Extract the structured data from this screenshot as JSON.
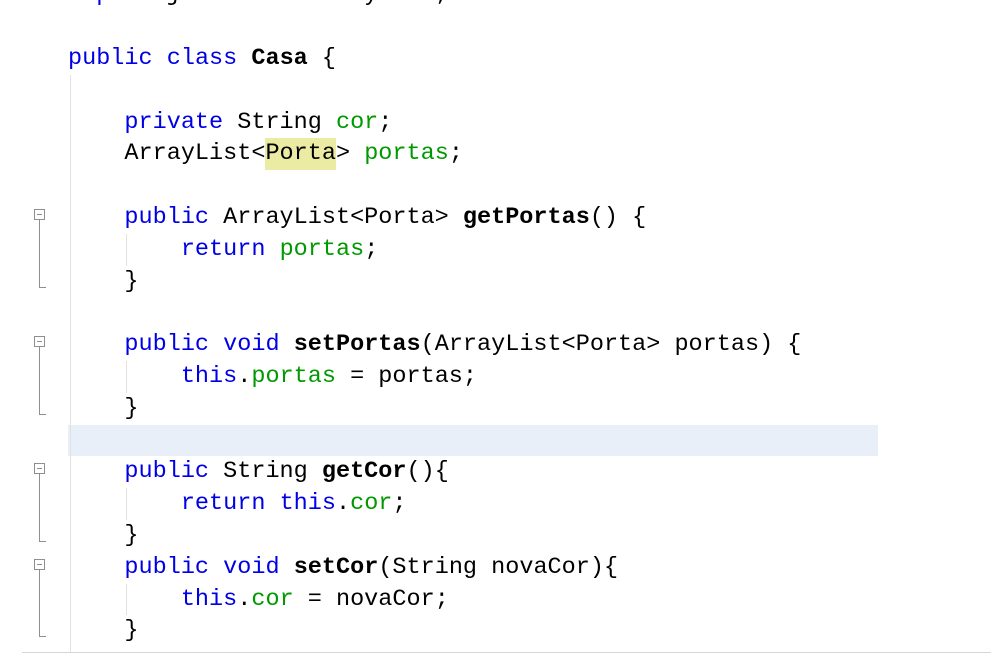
{
  "editor": {
    "language": "Java",
    "current_line": 14,
    "colors": {
      "background": "#ffffff",
      "text": "#000000",
      "keyword": "#0000e6",
      "field": "#009900",
      "current_line_bg": "#e9eff8",
      "occurrence_bg": "#eceba3",
      "fold_marker": "#8f8f8f",
      "indent_guide": "#e2e2e2",
      "border": "#d6d6d6"
    },
    "fold_icon": "fold-minus-icon",
    "blocks": [
      {
        "start": 0,
        "end": 0,
        "foldable": true
      },
      {
        "start": 2,
        "end": null,
        "foldable": false
      },
      {
        "start": 7,
        "end": 9,
        "foldable": true
      },
      {
        "start": 11,
        "end": 13,
        "foldable": true
      },
      {
        "start": 15,
        "end": 17,
        "foldable": true
      },
      {
        "start": 18,
        "end": 20,
        "foldable": true
      }
    ],
    "lines": [
      {
        "indent": 0,
        "tokens": [
          {
            "kind": "keyword",
            "text": "import"
          },
          {
            "kind": "text",
            "text": " java.util.ArrayList;"
          }
        ]
      },
      {
        "indent": 0,
        "tokens": []
      },
      {
        "indent": 0,
        "tokens": [
          {
            "kind": "keyword",
            "text": "public"
          },
          {
            "kind": "text",
            "text": " "
          },
          {
            "kind": "keyword",
            "text": "class"
          },
          {
            "kind": "text",
            "text": " "
          },
          {
            "kind": "declaration",
            "text": "Casa"
          },
          {
            "kind": "text",
            "text": " {"
          }
        ]
      },
      {
        "indent": 0,
        "tokens": []
      },
      {
        "indent": 4,
        "tokens": [
          {
            "kind": "keyword",
            "text": "private"
          },
          {
            "kind": "text",
            "text": " String "
          },
          {
            "kind": "field",
            "text": "cor"
          },
          {
            "kind": "text",
            "text": ";"
          }
        ]
      },
      {
        "indent": 4,
        "tokens": [
          {
            "kind": "text",
            "text": "ArrayList<"
          },
          {
            "kind": "occurrence",
            "text": "Porta"
          },
          {
            "kind": "text",
            "text": "> "
          },
          {
            "kind": "field",
            "text": "portas"
          },
          {
            "kind": "text",
            "text": ";"
          }
        ]
      },
      {
        "indent": 0,
        "tokens": []
      },
      {
        "indent": 4,
        "tokens": [
          {
            "kind": "keyword",
            "text": "public"
          },
          {
            "kind": "text",
            "text": " ArrayList<Porta> "
          },
          {
            "kind": "declaration",
            "text": "getPortas"
          },
          {
            "kind": "text",
            "text": "() {"
          }
        ]
      },
      {
        "indent": 8,
        "tokens": [
          {
            "kind": "keyword",
            "text": "return"
          },
          {
            "kind": "text",
            "text": " "
          },
          {
            "kind": "field",
            "text": "portas"
          },
          {
            "kind": "text",
            "text": ";"
          }
        ]
      },
      {
        "indent": 4,
        "tokens": [
          {
            "kind": "text",
            "text": "}"
          }
        ]
      },
      {
        "indent": 0,
        "tokens": []
      },
      {
        "indent": 4,
        "tokens": [
          {
            "kind": "keyword",
            "text": "public"
          },
          {
            "kind": "text",
            "text": " "
          },
          {
            "kind": "keyword",
            "text": "void"
          },
          {
            "kind": "text",
            "text": " "
          },
          {
            "kind": "declaration",
            "text": "setPortas"
          },
          {
            "kind": "text",
            "text": "(ArrayList<Porta> portas) {"
          }
        ]
      },
      {
        "indent": 8,
        "tokens": [
          {
            "kind": "keyword",
            "text": "this"
          },
          {
            "kind": "text",
            "text": "."
          },
          {
            "kind": "field",
            "text": "portas"
          },
          {
            "kind": "text",
            "text": " = portas;"
          }
        ]
      },
      {
        "indent": 4,
        "tokens": [
          {
            "kind": "text",
            "text": "}"
          }
        ]
      },
      {
        "indent": 0,
        "tokens": []
      },
      {
        "indent": 4,
        "tokens": [
          {
            "kind": "keyword",
            "text": "public"
          },
          {
            "kind": "text",
            "text": " String "
          },
          {
            "kind": "declaration",
            "text": "getCor"
          },
          {
            "kind": "text",
            "text": "(){"
          }
        ]
      },
      {
        "indent": 8,
        "tokens": [
          {
            "kind": "keyword",
            "text": "return"
          },
          {
            "kind": "text",
            "text": " "
          },
          {
            "kind": "keyword",
            "text": "this"
          },
          {
            "kind": "text",
            "text": "."
          },
          {
            "kind": "field",
            "text": "cor"
          },
          {
            "kind": "text",
            "text": ";"
          }
        ]
      },
      {
        "indent": 4,
        "tokens": [
          {
            "kind": "text",
            "text": "}"
          }
        ]
      },
      {
        "indent": 4,
        "tokens": [
          {
            "kind": "keyword",
            "text": "public"
          },
          {
            "kind": "text",
            "text": " "
          },
          {
            "kind": "keyword",
            "text": "void"
          },
          {
            "kind": "text",
            "text": " "
          },
          {
            "kind": "declaration",
            "text": "setCor"
          },
          {
            "kind": "text",
            "text": "(String novaCor){"
          }
        ]
      },
      {
        "indent": 8,
        "tokens": [
          {
            "kind": "keyword",
            "text": "this"
          },
          {
            "kind": "text",
            "text": "."
          },
          {
            "kind": "field",
            "text": "cor"
          },
          {
            "kind": "text",
            "text": " = novaCor;"
          }
        ]
      },
      {
        "indent": 4,
        "tokens": [
          {
            "kind": "text",
            "text": "}"
          }
        ]
      }
    ]
  }
}
